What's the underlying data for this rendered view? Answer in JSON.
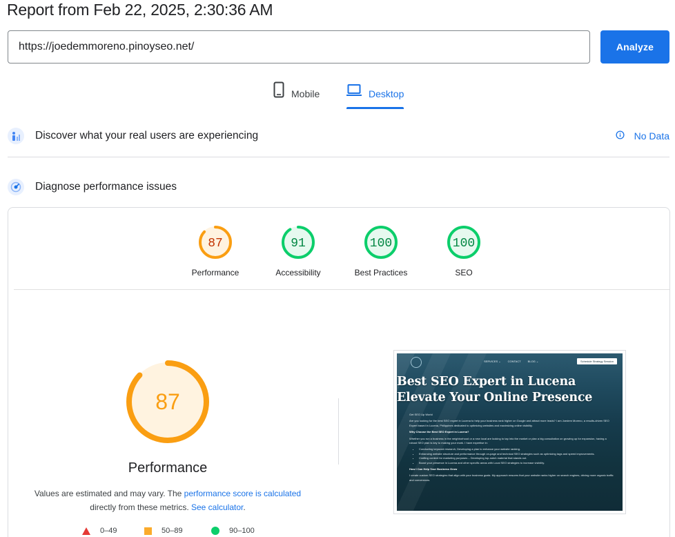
{
  "report": {
    "title": "Report from Feb 22, 2025, 2:30:36 AM"
  },
  "search": {
    "url": "https://joedemmoreno.pinoyseo.net/",
    "analyze_label": "Analyze"
  },
  "tabs": [
    {
      "label": "Mobile",
      "icon": "phone-icon",
      "active": false
    },
    {
      "label": "Desktop",
      "icon": "laptop-icon",
      "active": true
    }
  ],
  "sections": {
    "real_users": {
      "title": "Discover what your real users are experiencing",
      "status": "No Data",
      "status_icon": "info-icon"
    },
    "diagnose": {
      "title": "Diagnose performance issues"
    }
  },
  "scores": [
    {
      "label": "Performance",
      "value": "87",
      "color": "#fa9e12"
    },
    {
      "label": "Accessibility",
      "value": "91",
      "color": "#0cce6b"
    },
    {
      "label": "Best Practices",
      "value": "100",
      "color": "#0cce6b"
    },
    {
      "label": "SEO",
      "value": "100",
      "color": "#0cce6b"
    }
  ],
  "main_score": {
    "value": "87",
    "label": "Performance",
    "note_prefix": "Values are estimated and may vary. The ",
    "note_link": "performance score is calculated",
    "note_mid": "directly from these metrics. ",
    "note_link2": "See calculator",
    "note_suffix": "."
  },
  "legend": [
    {
      "range": "0–49",
      "shape": "triangle",
      "color": "#e53935"
    },
    {
      "range": "50–89",
      "shape": "square",
      "color": "#fbab2c"
    },
    {
      "range": "90–100",
      "shape": "circle",
      "color": "#0cce6b"
    }
  ],
  "screenshot": {
    "nav": [
      "SERVICES ⌄",
      "CONTACT",
      "BLOG ⌄"
    ],
    "cta": "Schedule Strategy Session",
    "heading1": "Best SEO Expert in Lucena",
    "heading2": "Elevate Your Online Presence",
    "kicker": "Get SEO Up World",
    "intro": "Are you looking for the best SEO expert in Lucena to help your business rank higher on Google and attract more leads? I am Joedem Moreno, a results-driven SEO Expert based in Lucena, Philippines dedicated to optimizing websites and maximizing online visibility.",
    "why_heading": "Why Choose the Best SEO Expert in Lucena?",
    "why_body": "Whether you run a business in the neighborhood or a new local are looking to tap into the market or plan a big consultation on growing up for expansion, having a robust SEO plan is key to making your mark. I have expertise in:",
    "bullets": [
      "Conducting keyword research, Developing a plan to enhance your website ranking.",
      "Enhancing website structure and performance through on-page and technical SEO strategies such as optimizing tags and speed improvements.",
      "Crafting content for marketing purposes – Developing top-notch material that stands out.",
      "Boost your presence in Lucena and other specific areas with Local SEO strategies to increase visibility."
    ],
    "help_heading": "How I Can Help Your Business Grow",
    "help_body": "I create custom SEO strategies that align with your business goals. My approach ensures that your website ranks higher on search engines, driving more organic traffic and conversions."
  }
}
